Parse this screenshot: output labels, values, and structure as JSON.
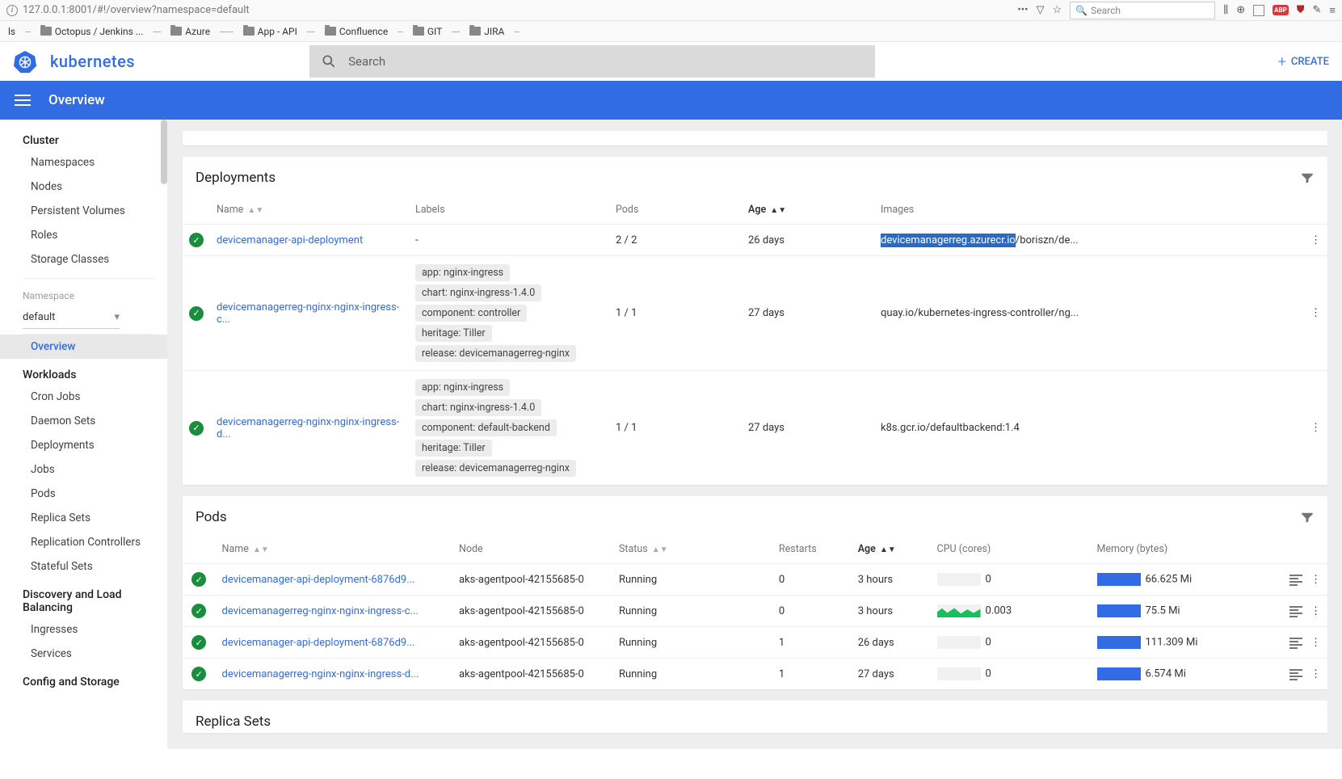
{
  "browser": {
    "url": "127.0.0.1:8001/#!/overview?namespace=default",
    "search_placeholder": "Search",
    "bookmarks": [
      {
        "label": "ls"
      },
      {
        "sep": "--"
      },
      {
        "label": "Octopus / Jenkins ..."
      },
      {
        "sep": "---"
      },
      {
        "label": "Azure"
      },
      {
        "sep": "-----"
      },
      {
        "label": "App - API"
      },
      {
        "sep": "---"
      },
      {
        "label": "Confluence"
      },
      {
        "sep": "--"
      },
      {
        "label": "GIT"
      },
      {
        "sep": "---"
      },
      {
        "label": "JIRA"
      },
      {
        "sep": "--"
      }
    ]
  },
  "app": {
    "brand": "kubernetes",
    "search_placeholder": "Search",
    "create_label": "CREATE",
    "page_title": "Overview"
  },
  "sidebar": {
    "cluster_section": "Cluster",
    "cluster_items": [
      "Namespaces",
      "Nodes",
      "Persistent Volumes",
      "Roles",
      "Storage Classes"
    ],
    "namespace_label": "Namespace",
    "namespace_value": "default",
    "overview": "Overview",
    "workloads_section": "Workloads",
    "workloads_items": [
      "Cron Jobs",
      "Daemon Sets",
      "Deployments",
      "Jobs",
      "Pods",
      "Replica Sets",
      "Replication Controllers",
      "Stateful Sets"
    ],
    "discovery_section": "Discovery and Load Balancing",
    "discovery_items": [
      "Ingresses",
      "Services"
    ],
    "config_section": "Config and Storage"
  },
  "deployments": {
    "title": "Deployments",
    "headers": {
      "name": "Name",
      "labels": "Labels",
      "pods": "Pods",
      "age": "Age",
      "images": "Images"
    },
    "rows": [
      {
        "name": "devicemanager-api-deployment",
        "labels": [
          "-"
        ],
        "pods": "2 / 2",
        "age": "26 days",
        "image_hl": "devicemanagerreg.azurecr.io",
        "image_rest": "/boriszn/de..."
      },
      {
        "name": "devicemanagerreg-nginx-nginx-ingress-c...",
        "labels": [
          "app: nginx-ingress",
          "chart: nginx-ingress-1.4.0",
          "component: controller",
          "heritage: Tiller",
          "release: devicemanagerreg-nginx"
        ],
        "pods": "1 / 1",
        "age": "27 days",
        "image": "quay.io/kubernetes-ingress-controller/ng..."
      },
      {
        "name": "devicemanagerreg-nginx-nginx-ingress-d...",
        "labels": [
          "app: nginx-ingress",
          "chart: nginx-ingress-1.4.0",
          "component: default-backend",
          "heritage: Tiller",
          "release: devicemanagerreg-nginx"
        ],
        "pods": "1 / 1",
        "age": "27 days",
        "image": "k8s.gcr.io/defaultbackend:1.4"
      }
    ]
  },
  "pods": {
    "title": "Pods",
    "headers": {
      "name": "Name",
      "node": "Node",
      "status": "Status",
      "restarts": "Restarts",
      "age": "Age",
      "cpu": "CPU (cores)",
      "mem": "Memory (bytes)"
    },
    "rows": [
      {
        "name": "devicemanager-api-deployment-6876d9...",
        "node": "aks-agentpool-42155685-0",
        "status": "Running",
        "restarts": "0",
        "age": "3 hours",
        "cpu": "0",
        "cpu_spark": false,
        "mem": "66.625 Mi"
      },
      {
        "name": "devicemanagerreg-nginx-nginx-ingress-c...",
        "node": "aks-agentpool-42155685-0",
        "status": "Running",
        "restarts": "0",
        "age": "3 hours",
        "cpu": "0.003",
        "cpu_spark": true,
        "mem": "75.5 Mi"
      },
      {
        "name": "devicemanager-api-deployment-6876d9...",
        "node": "aks-agentpool-42155685-0",
        "status": "Running",
        "restarts": "1",
        "age": "26 days",
        "cpu": "0",
        "cpu_spark": false,
        "mem": "111.309 Mi"
      },
      {
        "name": "devicemanagerreg-nginx-nginx-ingress-d...",
        "node": "aks-agentpool-42155685-0",
        "status": "Running",
        "restarts": "1",
        "age": "27 days",
        "cpu": "0",
        "cpu_spark": false,
        "mem": "6.574 Mi"
      }
    ]
  },
  "replicasets": {
    "title": "Replica Sets"
  }
}
